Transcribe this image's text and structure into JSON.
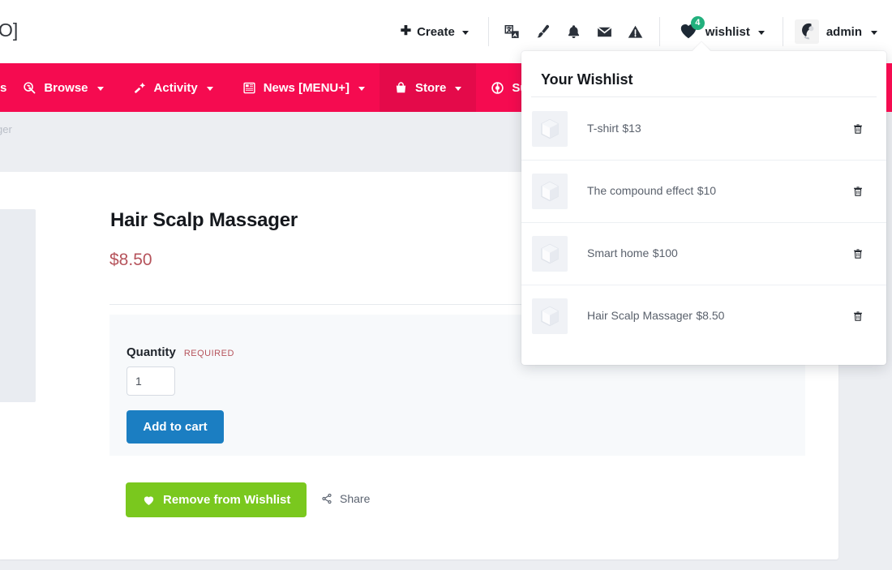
{
  "header": {
    "logo_text": "O]",
    "create_label": "Create",
    "icons": [
      {
        "name": "translate-icon",
        "label": "translate"
      },
      {
        "name": "paintbrush-icon",
        "label": "appearance"
      },
      {
        "name": "bell-icon",
        "label": "notifications"
      },
      {
        "name": "envelope-icon",
        "label": "messages"
      },
      {
        "name": "warning-icon",
        "label": "alerts"
      }
    ],
    "wishlist_label": "wishlist",
    "wishlist_count": "4",
    "wishlist_badge_color": "#22b07d",
    "admin_label": "admin"
  },
  "nav": {
    "bar_color": "#f50b50",
    "clipped_item": "s",
    "items": [
      {
        "label": "Browse",
        "icon": "browse-icon",
        "active": false
      },
      {
        "label": "Activity",
        "icon": "activity-icon",
        "active": false
      },
      {
        "label": "News [MENU+]",
        "icon": "news-icon",
        "active": false
      },
      {
        "label": "Store",
        "icon": "store-bag-icon",
        "active": true
      },
      {
        "label": "Support",
        "icon": "support-lifering-icon",
        "active": false
      }
    ]
  },
  "breadcrumb": {
    "text": "ger"
  },
  "product": {
    "title": "Hair Scalp Massager",
    "price": "$8.50",
    "price_color": "#b6545c",
    "quantity_label": "Quantity",
    "quantity_required_label": "REQUIRED",
    "quantity_value": "1",
    "add_to_cart_label": "Add to cart",
    "add_to_cart_color": "#1b7ec2",
    "remove_wishlist_label": "Remove from Wishlist",
    "remove_wishlist_color": "#7ac81e",
    "share_label": "Share"
  },
  "wishlist_dropdown": {
    "title": "Your Wishlist",
    "items": [
      {
        "name": "T-shirt",
        "price": "$13"
      },
      {
        "name": "The compound effect",
        "price": "$10"
      },
      {
        "name": "Smart home",
        "price": "$100"
      },
      {
        "name": "Hair Scalp Massager",
        "price": "$8.50"
      }
    ]
  }
}
